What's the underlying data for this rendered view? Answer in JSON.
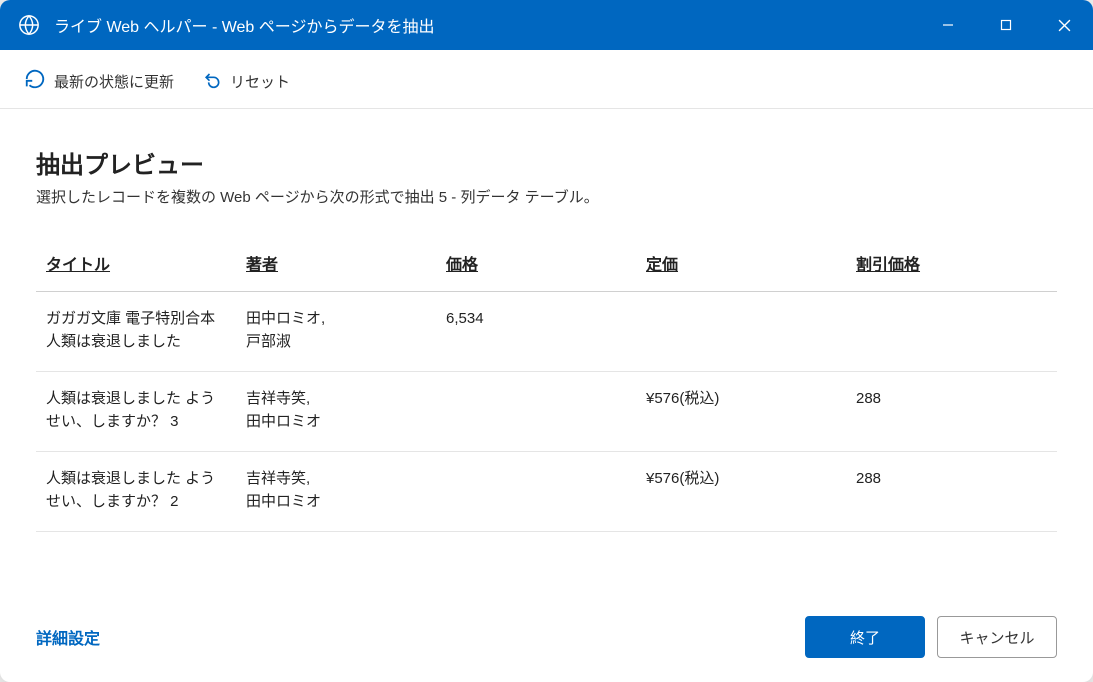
{
  "titlebar": {
    "title": "ライブ Web ヘルパー - Web ページからデータを抽出"
  },
  "toolbar": {
    "refresh": "最新の状態に更新",
    "reset": "リセット"
  },
  "preview": {
    "title": "抽出プレビュー",
    "description": "選択したレコードを複数の Web ページから次の形式で抽出 5 - 列データ テーブル。"
  },
  "table": {
    "headers": [
      "タイトル",
      "著者",
      "価格",
      "定価",
      "割引価格"
    ],
    "rows": [
      {
        "title": "ガガガ文庫 電子特別合本 人類は衰退しました",
        "author": "田中ロミオ,\n戸部淑",
        "price": "6,534",
        "list_price": "",
        "discount": ""
      },
      {
        "title": "人類は衰退しました ようせい、しますか？ 3",
        "author": "吉祥寺笑,\n田中ロミオ",
        "price": "",
        "list_price": "¥576(税込)",
        "discount": "288"
      },
      {
        "title": "人類は衰退しました ようせい、しますか？ 2",
        "author": "吉祥寺笑,\n田中ロミオ",
        "price": "",
        "list_price": "¥576(税込)",
        "discount": "288"
      }
    ]
  },
  "footer": {
    "advanced": "詳細設定",
    "finish": "終了",
    "cancel": "キャンセル"
  }
}
